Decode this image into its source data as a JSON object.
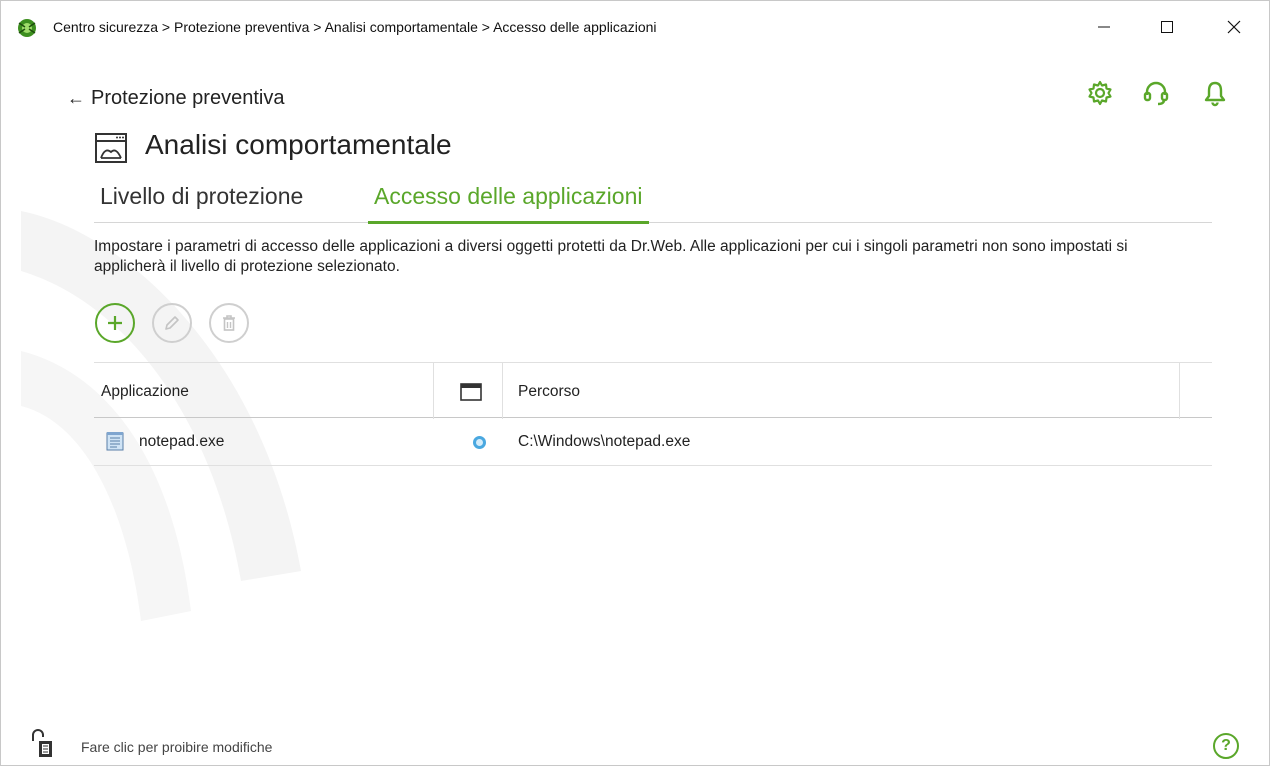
{
  "window": {
    "breadcrumb": "Centro sicurezza > Protezione preventiva > Analisi comportamentale > Accesso delle applicazioni"
  },
  "header": {
    "back_label": "Protezione preventiva",
    "section_title": "Analisi comportamentale",
    "icons": [
      "gear-icon",
      "support-headset-icon",
      "bell-icon"
    ]
  },
  "tabs": [
    {
      "label": "Livello di protezione",
      "active": false
    },
    {
      "label": "Accesso delle applicazioni",
      "active": true
    }
  ],
  "description": "Impostare i parametri di accesso delle applicazioni a diversi oggetti protetti da Dr.Web. Alle applicazioni per cui i singoli parametri non sono impostati si applicherà il livello di protezione selezionato.",
  "toolbar": {
    "buttons": [
      "add-icon",
      "edit-icon",
      "delete-icon"
    ]
  },
  "table": {
    "columns": [
      "Applicazione",
      "",
      "Percorso"
    ],
    "rows": [
      {
        "app": "notepad.exe",
        "path": "C:\\Windows\\notepad.exe"
      }
    ]
  },
  "footer": {
    "lock_text": "Fare clic per proibire modifiche",
    "help": "?"
  },
  "colors": {
    "accent": "#5aa72a",
    "status_blue": "#4aa8e0"
  }
}
